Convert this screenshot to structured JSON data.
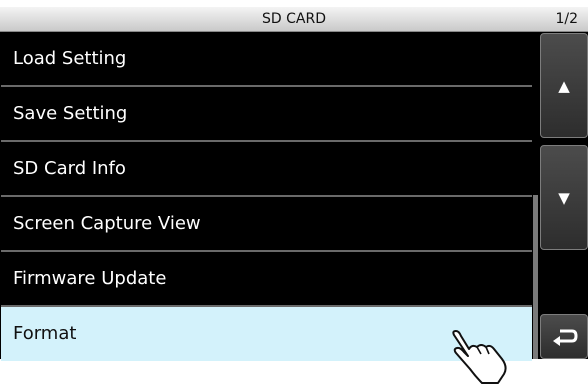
{
  "header": {
    "title": "SD CARD",
    "page_indicator": "1/2"
  },
  "menu": {
    "items": [
      {
        "label": "Load Setting"
      },
      {
        "label": "Save Setting"
      },
      {
        "label": "SD Card Info"
      },
      {
        "label": "Screen Capture View"
      },
      {
        "label": "Firmware Update"
      },
      {
        "label": "Format"
      }
    ],
    "selected_index": 5
  },
  "buttons": {
    "up": {
      "icon": "triangle-up-icon",
      "glyph": "▲"
    },
    "down": {
      "icon": "triangle-down-icon",
      "glyph": "▼"
    },
    "back": {
      "icon": "return-arrow-icon"
    }
  },
  "colors": {
    "selected_bg": "#d3f2fb",
    "background": "#000000"
  }
}
